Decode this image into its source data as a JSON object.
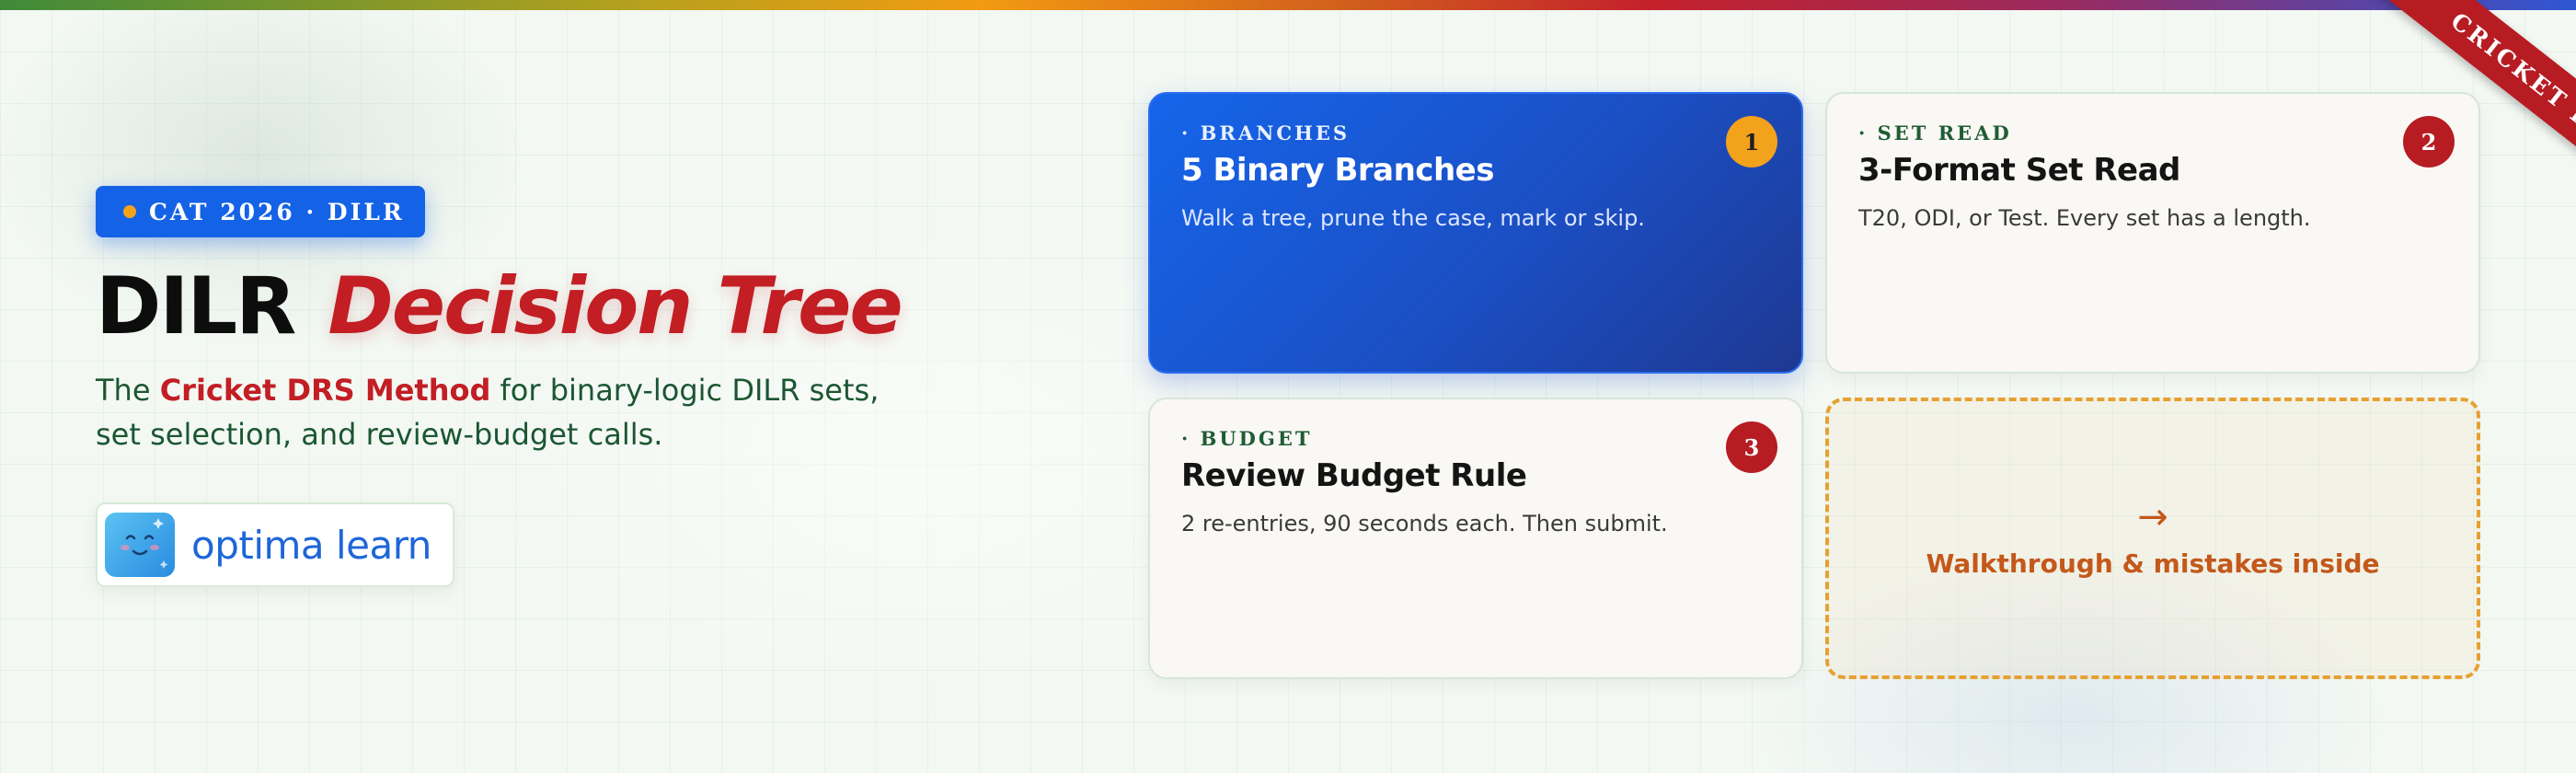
{
  "banner": {
    "ribbon_text": "CRICKET DRS",
    "badge_text": "CAT 2026 · DILR",
    "title_plain": "DILR",
    "title_highlight": "Decision Tree",
    "subtitle_prefix": "The ",
    "subtitle_highlight": "Cricket DRS Method",
    "subtitle_suffix": " for binary-logic DILR sets, set selection, and review-budget calls.",
    "logo_text": "optima learn"
  },
  "cards": [
    {
      "tag": "· BRANCHES",
      "number": "1",
      "title": "5 Binary Branches",
      "desc": "Walk a tree, prune the case, mark or skip."
    },
    {
      "tag": "· SET READ",
      "number": "2",
      "title": "3-Format Set Read",
      "desc": "T20, ODI, or Test. Every set has a length."
    },
    {
      "tag": "· BUDGET",
      "number": "3",
      "title": "Review Budget Rule",
      "desc": "2 re-entries, 90 seconds each. Then submit."
    }
  ],
  "cta": {
    "arrow": "→",
    "label": "Walkthrough & mistakes inside"
  },
  "colors": {
    "brand_blue": "#1462e6",
    "accent_red": "#c21e24",
    "accent_gold": "#f3a21c",
    "text_green": "#1b5632"
  },
  "icons": {
    "logo": "smiling-face-logo-icon",
    "arrow": "arrow-right-icon"
  }
}
